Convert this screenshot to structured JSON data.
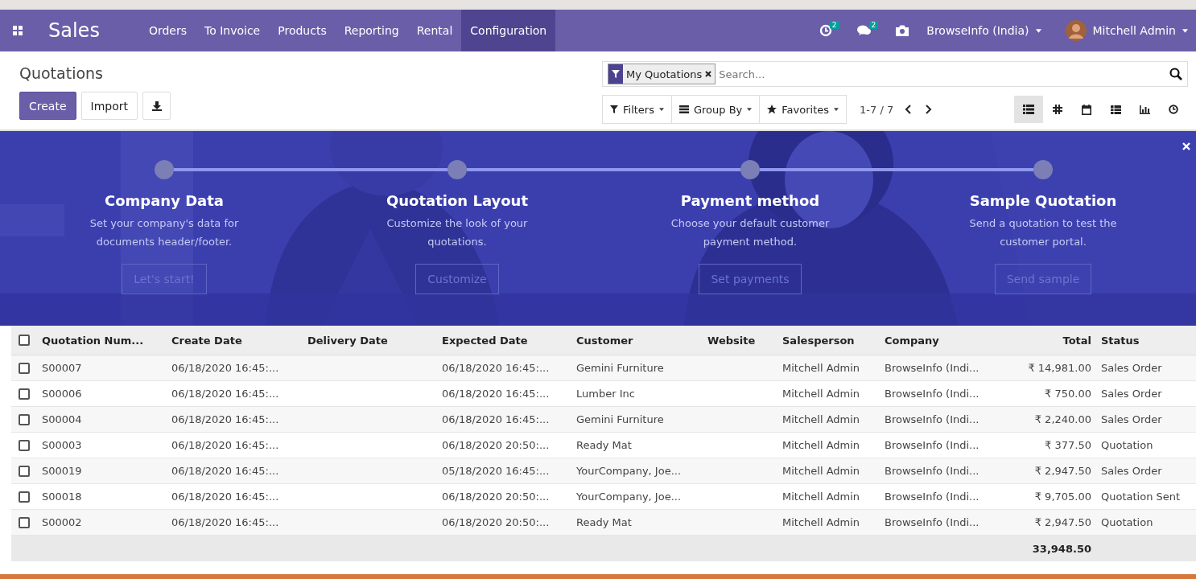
{
  "navbar": {
    "app_title": "Sales",
    "menu": [
      {
        "label": "Orders",
        "selected": false
      },
      {
        "label": "To Invoice",
        "selected": false
      },
      {
        "label": "Products",
        "selected": false
      },
      {
        "label": "Reporting",
        "selected": false
      },
      {
        "label": "Rental",
        "selected": false
      },
      {
        "label": "Configuration",
        "selected": true
      }
    ],
    "activity_badge": "2",
    "messages_badge": "2",
    "company": "BrowseInfo (India)",
    "user": "Mitchell Admin"
  },
  "control_panel": {
    "breadcrumb": "Quotations",
    "buttons": [
      {
        "label": "Create",
        "kind": "primary"
      },
      {
        "label": "Import",
        "kind": "secondary"
      }
    ],
    "search": {
      "facet": "My Quotations",
      "placeholder": "Search..."
    },
    "filters": [
      "Filters",
      "Group By",
      "Favorites"
    ],
    "pager": "1-7 / 7",
    "views": [
      {
        "kind": "list",
        "selected": true
      },
      {
        "kind": "kanban",
        "selected": false
      },
      {
        "kind": "calendar",
        "selected": false
      },
      {
        "kind": "pivot",
        "selected": false
      },
      {
        "kind": "graph",
        "selected": false
      },
      {
        "kind": "activity",
        "selected": false
      }
    ]
  },
  "banner": {
    "kind": "picture",
    "steps": [
      {
        "title": "Company Data",
        "description": "Set your company's data for documents header/footer.",
        "button": "Let's start!"
      },
      {
        "title": "Quotation Layout",
        "description": "Customize the look of your quotations.",
        "button": "Customize"
      },
      {
        "title": "Payment method",
        "description": "Choose your default customer payment method.",
        "button": "Set payments"
      },
      {
        "title": "Sample Quotation",
        "description": "Send a quotation to test the customer portal.",
        "button": "Send sample"
      }
    ]
  },
  "table": {
    "select_all": {
      "checked": false
    },
    "columns": [
      "Quotation Num...",
      "Create Date",
      "Delivery Date",
      "Expected Date",
      "Customer",
      "Website",
      "Salesperson",
      "Company",
      "Total",
      "Status"
    ],
    "rows": [
      {
        "checked": false,
        "cells": [
          "S00007",
          "06/18/2020 16:45:...",
          "",
          "06/18/2020 16:45:...",
          "Gemini Furniture",
          "",
          "Mitchell Admin",
          "BrowseInfo (Indi...",
          "₹ 14,981.00",
          "Sales Order"
        ]
      },
      {
        "checked": false,
        "cells": [
          "S00006",
          "06/18/2020 16:45:...",
          "",
          "06/18/2020 16:45:...",
          "Lumber Inc",
          "",
          "Mitchell Admin",
          "BrowseInfo (Indi...",
          "₹ 750.00",
          "Sales Order"
        ]
      },
      {
        "checked": false,
        "cells": [
          "S00004",
          "06/18/2020 16:45:...",
          "",
          "06/18/2020 16:45:...",
          "Gemini Furniture",
          "",
          "Mitchell Admin",
          "BrowseInfo (Indi...",
          "₹ 2,240.00",
          "Sales Order"
        ]
      },
      {
        "checked": false,
        "cells": [
          "S00003",
          "06/18/2020 16:45:...",
          "",
          "06/18/2020 20:50:...",
          "Ready Mat",
          "",
          "Mitchell Admin",
          "BrowseInfo (Indi...",
          "₹ 377.50",
          "Quotation"
        ]
      },
      {
        "checked": false,
        "cells": [
          "S00019",
          "06/18/2020 16:45:...",
          "",
          "05/18/2020 16:45:...",
          "YourCompany, Joe...",
          "",
          "Mitchell Admin",
          "BrowseInfo (Indi...",
          "₹ 2,947.50",
          "Sales Order"
        ]
      },
      {
        "checked": false,
        "cells": [
          "S00018",
          "06/18/2020 16:45:...",
          "",
          "06/18/2020 20:50:...",
          "YourCompany, Joe...",
          "",
          "Mitchell Admin",
          "BrowseInfo (Indi...",
          "₹ 9,705.00",
          "Quotation Sent"
        ]
      },
      {
        "checked": false,
        "cells": [
          "S00002",
          "06/18/2020 16:45:...",
          "",
          "06/18/2020 20:50:...",
          "Ready Mat",
          "",
          "Mitchell Admin",
          "BrowseInfo (Indi...",
          "₹ 2,947.50",
          "Quotation"
        ]
      }
    ],
    "total": "33,948.50"
  }
}
